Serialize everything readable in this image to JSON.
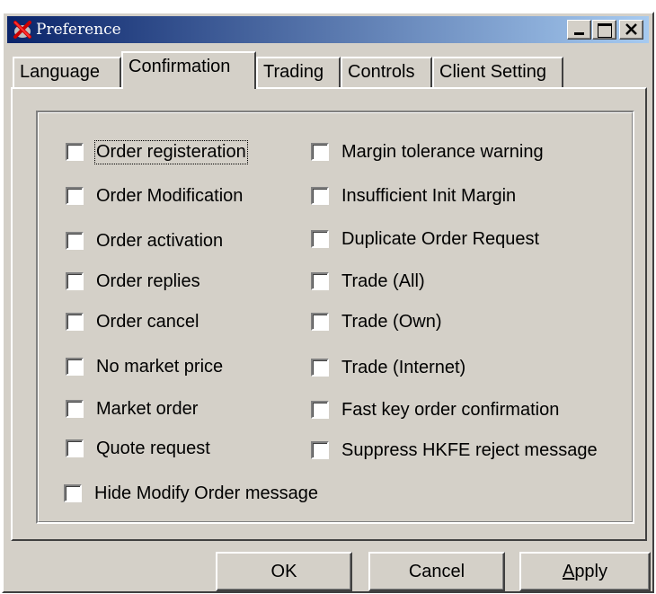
{
  "window": {
    "title": "Preference"
  },
  "tabs": [
    {
      "label": "Language",
      "active": false
    },
    {
      "label": "Confirmation",
      "active": true
    },
    {
      "label": "Trading",
      "active": false
    },
    {
      "label": "Controls",
      "active": false
    },
    {
      "label": "Client Setting",
      "active": false
    }
  ],
  "left_options": [
    {
      "label": "Order registeration",
      "checked": false
    },
    {
      "label": "Order Modification",
      "checked": false
    },
    {
      "label": "Order activation",
      "checked": false
    },
    {
      "label": "Order replies",
      "checked": false
    },
    {
      "label": "Order cancel",
      "checked": false
    },
    {
      "label": "No market price",
      "checked": false
    },
    {
      "label": "Market order",
      "checked": false
    },
    {
      "label": "Quote request",
      "checked": false
    },
    {
      "label": "Hide Modify Order message",
      "checked": false
    }
  ],
  "right_options": [
    {
      "label": "Margin tolerance warning",
      "checked": false
    },
    {
      "label": "Insufficient Init Margin",
      "checked": false
    },
    {
      "label": "Duplicate Order Request",
      "checked": false
    },
    {
      "label": "Trade (All)",
      "checked": false
    },
    {
      "label": "Trade (Own)",
      "checked": false
    },
    {
      "label": "Trade (Internet)",
      "checked": false
    },
    {
      "label": "Fast key order confirmation",
      "checked": false
    },
    {
      "label": "Suppress HKFE reject message",
      "checked": false
    }
  ],
  "buttons": {
    "ok": "OK",
    "cancel": "Cancel",
    "apply_prefix": "",
    "apply_key": "A",
    "apply_rest": "pply"
  },
  "icons": {
    "app": "x-logo-icon",
    "minimize": "minimize-icon",
    "maximize": "maximize-icon",
    "close": "close-icon"
  },
  "colors": {
    "title_start": "#0a246a",
    "title_end": "#a6caf0",
    "face": "#d4d0c8"
  }
}
